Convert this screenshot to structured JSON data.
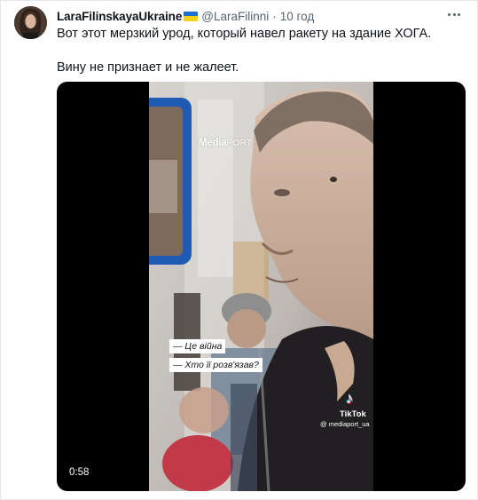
{
  "tweet": {
    "author": {
      "display_name": "LaraFilinskayaUkraine",
      "handle": "@LaraFilinni",
      "separator": "·",
      "time": "10 год",
      "flag": "ukraine-flag"
    },
    "text_lines": [
      "Вот этот мерзкий урод, который навел ракету на здание ХОГА.",
      "Вину не признает и не жалеет."
    ],
    "more_icon": "more-horizontal-icon"
  },
  "video": {
    "duration": "0:58",
    "watermark": {
      "brand_bold": "Media",
      "brand_light": "PORT"
    },
    "subtitles": [
      "— Це війна",
      "— Хто її розв'язав?"
    ],
    "tiktok": {
      "glyph": "♪",
      "name": "TikTok",
      "user": "@ mediaport_ua"
    }
  },
  "colors": {
    "name": "#0f1419",
    "secondary": "#536471",
    "flag_blue": "#1f6fd1",
    "flag_yellow": "#f5d218",
    "media_bg": "#000000"
  }
}
